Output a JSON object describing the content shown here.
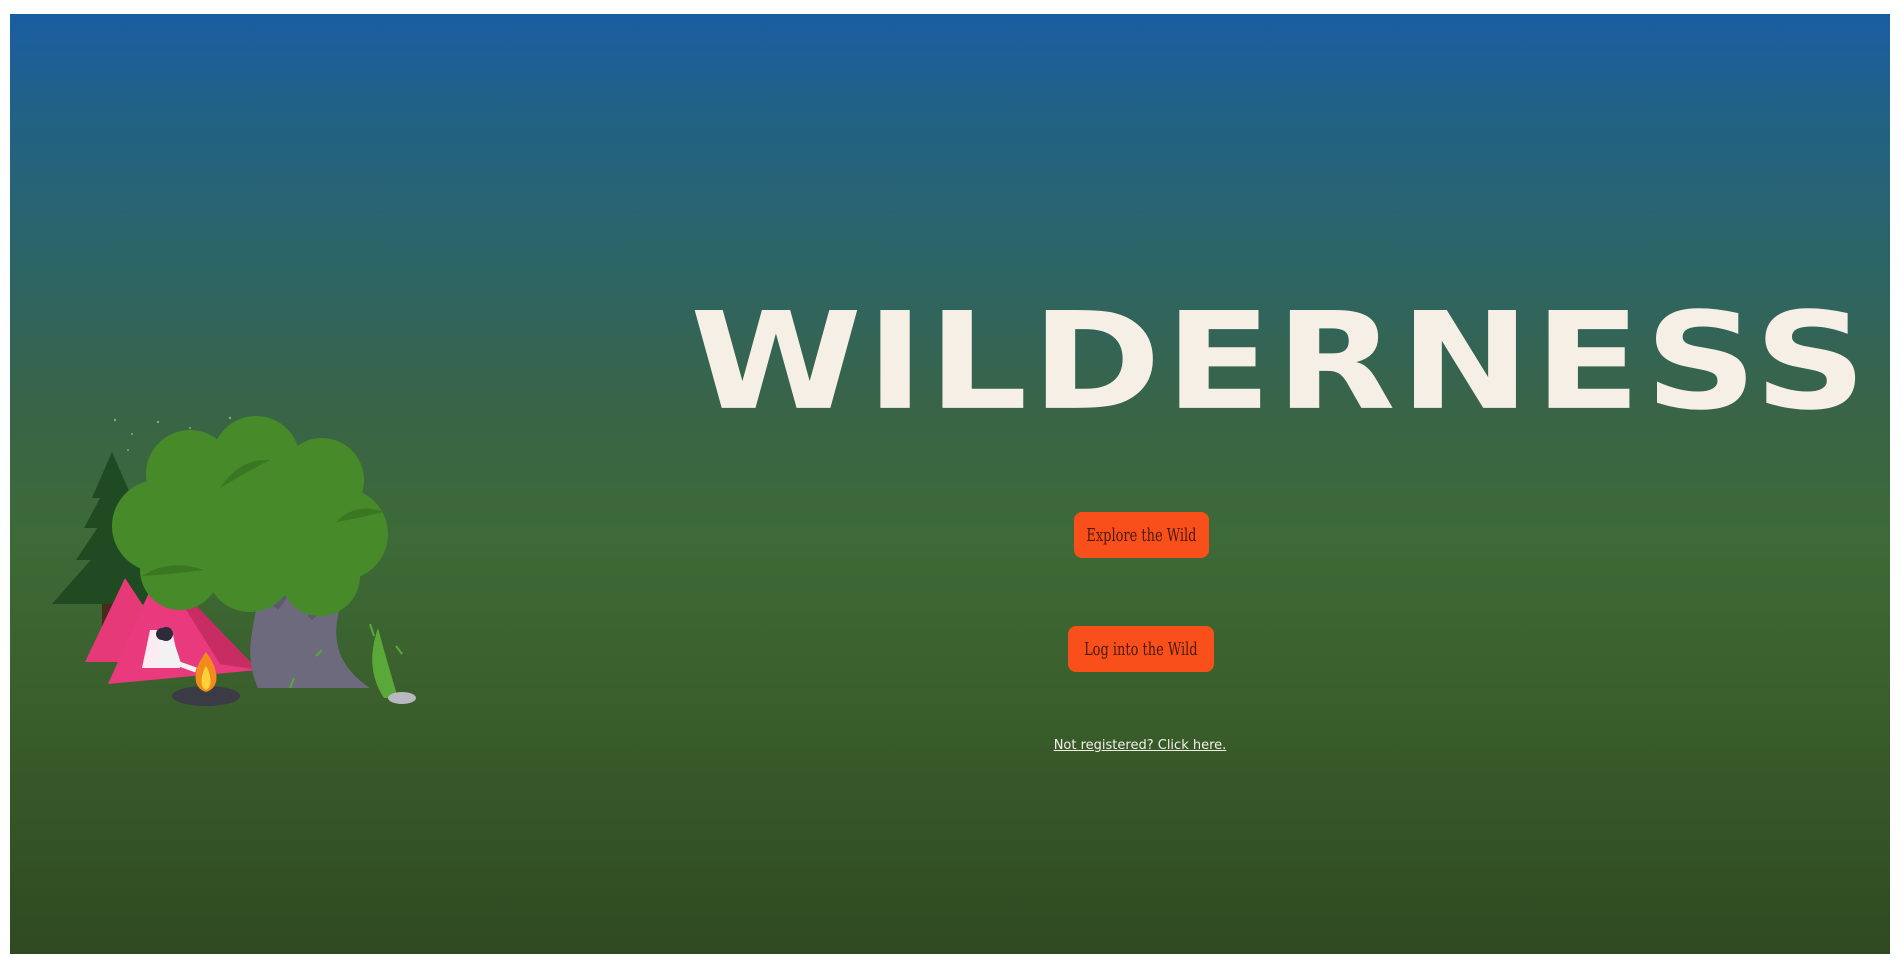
{
  "hero": {
    "title": "WILDERNESS"
  },
  "actions": {
    "explore_label": "Explore the Wild",
    "login_label": "Log into the Wild",
    "register_link": "Not registered? Click here."
  },
  "illustration": {
    "icon": "camping-scene-illustration",
    "colors": {
      "tree_canopy": "#468a2a",
      "pine": "#1f4a22",
      "tent": "#e63a78",
      "trunk": "#6d6a7d",
      "fire": "#f59b1c"
    }
  },
  "theme": {
    "gradient_top": "#1a5ea2",
    "gradient_bottom": "#2f4a21",
    "accent": "#f94f1b",
    "title_color": "#f6efe6"
  }
}
